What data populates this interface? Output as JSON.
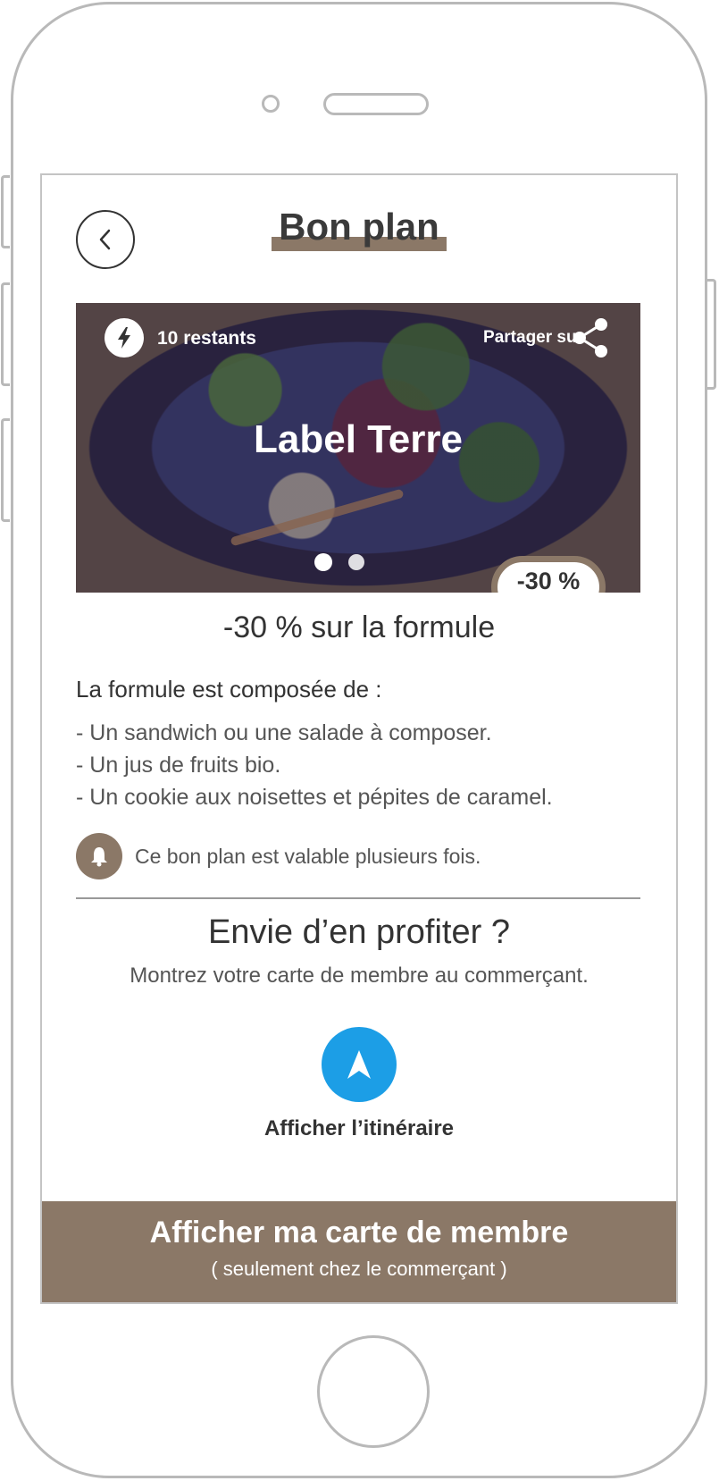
{
  "header": {
    "title": "Bon plan"
  },
  "hero": {
    "remaining": "10 restants",
    "share_label": "Partager sur",
    "title": "Label Terre",
    "discount_badge": "-30 %",
    "carousel_dots": 2
  },
  "offer": {
    "title": "-30 % sur la formule",
    "composition_heading": "La formule est composée de :",
    "items": [
      "- Un sandwich ou une salade à composer.",
      "- Un jus de fruits bio.",
      "- Un cookie aux noisettes et pépites de caramel."
    ],
    "info_text": "Ce bon plan est valable plusieurs fois."
  },
  "cta": {
    "title": "Envie d’en profiter ?",
    "subtitle": "Montrez votre carte de membre au commerçant.",
    "route_label": "Afficher l’itinéraire"
  },
  "member_button": {
    "label": "Afficher ma carte de membre",
    "sublabel": "( seulement chez le commerçant )"
  },
  "colors": {
    "accent": "#8b7867",
    "nav_blue": "#1c9ee6",
    "text": "#333333"
  },
  "icons": [
    "chevron-left-icon",
    "lightning-icon",
    "share-icon",
    "bell-icon",
    "navigation-arrow-icon"
  ]
}
